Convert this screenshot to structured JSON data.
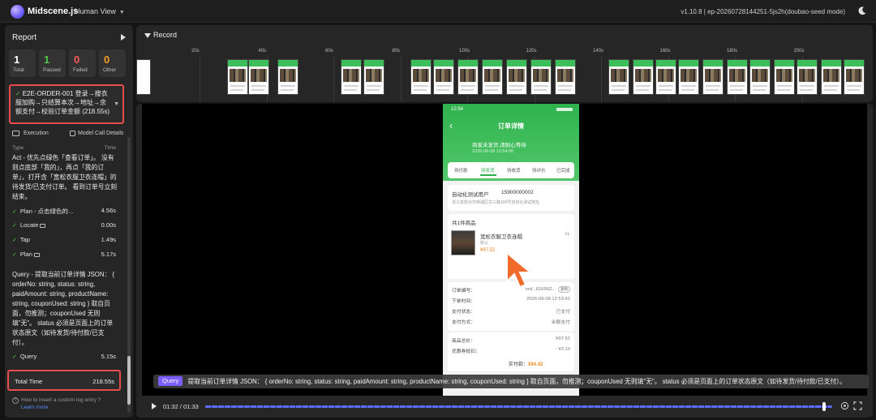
{
  "app": {
    "brand": "Midscene.js",
    "view_mode": "Human View",
    "version": "v1.10.8 | ep-20260728144251-5js2h(doubao-seed mode)"
  },
  "sidebar": {
    "title": "Report",
    "stats": [
      {
        "num": "1",
        "label": "Total",
        "color": "#ffffff"
      },
      {
        "num": "1",
        "label": "Passed",
        "color": "#4ec94e"
      },
      {
        "num": "0",
        "label": "Failed",
        "color": "#ff5a5a"
      },
      {
        "num": "0",
        "label": "Other",
        "color": "#f0a020"
      }
    ],
    "case_title": "E2E-ORDER-001 登录→搜衣服加购→只结算本次→地址→余额支付→校验订单金额 (218.55s)",
    "execution_label": "Execution",
    "model_call_label": "Model Call Details",
    "col_type": "Type",
    "col_time": "Time",
    "act_task": "Act - 优先点绿色「查看订单」。 没有则点底部「我的」，再点「我的订单」，打开含「宽松衣服卫衣连帽」的待发货/已支付订单。 看到订单号立刻结束。",
    "steps": [
      {
        "label": "Plan - 点击绿色的...",
        "time": "4.56s"
      },
      {
        "label": "Locate",
        "time": "0.00s"
      },
      {
        "label": "Tap",
        "time": "1.49s"
      },
      {
        "label": "Plan",
        "time": "5.17s"
      }
    ],
    "query_task": "Query - 提取当前订单详情 JSON： { orderNo: string, status: string, paidAmount: string, productName: string, couponUsed: string } 取自页面，勿推测；couponUsed 无则填\"无\"。 status 必须是页面上的订单状态原文（如待发货/待付款/已支付）。",
    "query_step": {
      "label": "Query",
      "time": "5.15s"
    },
    "total_label": "Total Time",
    "total_value": "218.55s",
    "help_text": "How to insert a custom log entry ?",
    "learn_more": "Learn more"
  },
  "record": {
    "title": "Record",
    "ticks": [
      "20s",
      "40s",
      "60s",
      "80s",
      "100s",
      "120s",
      "140s",
      "160s",
      "180s",
      "200s"
    ]
  },
  "phone": {
    "status_time": "12:54",
    "title": "订单详情",
    "sub1": "商家未发货,请耐心等待",
    "sub2": "2026-08-08 12:54:05",
    "tabs": [
      "待付款",
      "待发货",
      "待收货",
      "待评价",
      "已完成"
    ],
    "addr_name": "自动化测试用户",
    "addr_phone": "15900000002",
    "addr_line": "浙江省杭州市西湖区文三路100号自动化测试地址",
    "goods_head": "共1件商品",
    "goods_name": "宽松衣服卫衣连帽",
    "goods_spec": "默认",
    "goods_price": "¥97.52",
    "goods_qty": "x1",
    "order_no_label": "订单编号：",
    "order_no_value": "ord...616562...",
    "copy_label": "复制",
    "order_time_label": "下单时间：",
    "order_time_value": "2026-08-08 12:53:42",
    "pay_status_label": "支付状态：",
    "pay_status_value": "已支付",
    "pay_method_label": "支付方式：",
    "pay_method_value": "余额支付",
    "goods_total_label": "商品总价：",
    "goods_total_value": "¥97.52",
    "coupon_label": "优惠券抵扣：",
    "coupon_value": "- ¥3.10",
    "paid_label": "实付款：",
    "paid_value": "¥94.42"
  },
  "player": {
    "caption_badge": "Query",
    "caption_text": "提取当前订单详情 JSON： { orderNo: string, status: string, paidAmount: string, productName: string, couponUsed: string } 取自页面，勿推测；couponUsed 无则填\"无\"。 status 必须是页面上的订单状态原文（如待发货/待付款/已支付）。",
    "time": "01:32 / 01:33",
    "progress": 0.99
  },
  "colors": {
    "accent": "#7b5cff",
    "highlight_border": "#e84c4c",
    "success": "#4ec94e",
    "phone_green": "#2fb24e"
  }
}
